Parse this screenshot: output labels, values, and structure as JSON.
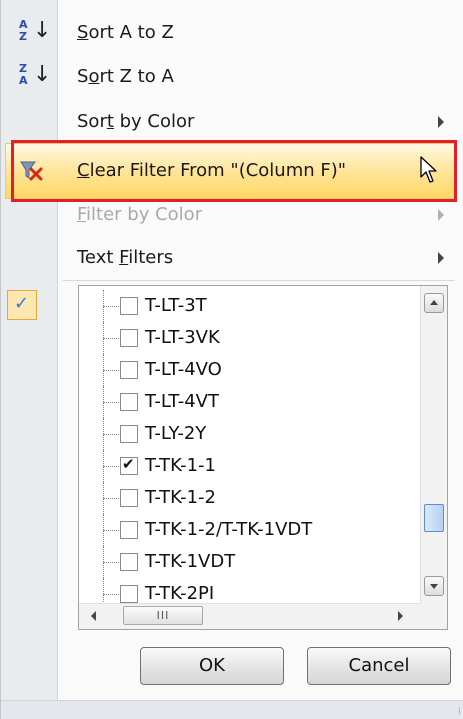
{
  "menu": {
    "sort_az": {
      "label_pre": "",
      "mnemonic": "S",
      "label_post": "ort A to Z",
      "icon_top": "A",
      "icon_bottom": "Z"
    },
    "sort_za": {
      "label_pre": "S",
      "mnemonic": "o",
      "label_post": "rt Z to A",
      "icon_top": "Z",
      "icon_bottom": "A"
    },
    "sort_color": {
      "label_pre": "Sor",
      "mnemonic": "t",
      "label_post": " by Color"
    },
    "clear_filter": {
      "label_pre": "",
      "mnemonic": "C",
      "label_post": "lear Filter From \"(Column F)\""
    },
    "filter_color": {
      "label_pre": "",
      "mnemonic": "F",
      "label_post": "ilter by Color"
    },
    "text_filters": {
      "label_pre": "Text ",
      "mnemonic": "F",
      "label_post": "ilters"
    }
  },
  "list": {
    "items": [
      {
        "label": "T-LT-3T",
        "checked": false
      },
      {
        "label": "T-LT-3VK",
        "checked": false
      },
      {
        "label": "T-LT-4VO",
        "checked": false
      },
      {
        "label": "T-LT-4VT",
        "checked": false
      },
      {
        "label": "T-LY-2Y",
        "checked": false
      },
      {
        "label": "T-TK-1-1",
        "checked": true
      },
      {
        "label": "T-TK-1-2",
        "checked": false
      },
      {
        "label": "T-TK-1-2/T-TK-1VDT",
        "checked": false
      },
      {
        "label": "T-TK-1VDT",
        "checked": false
      },
      {
        "label": "T-TK-2PI",
        "checked": false
      }
    ],
    "hscroll_thumb_glyph": "III"
  },
  "gutter": {
    "checkmark": "✓"
  },
  "buttons": {
    "ok": "OK",
    "cancel": "Cancel"
  },
  "colors": {
    "highlight": "#ffe59a",
    "outline": "#e41e2a",
    "scroll_thumb": "#b7d0f3"
  }
}
